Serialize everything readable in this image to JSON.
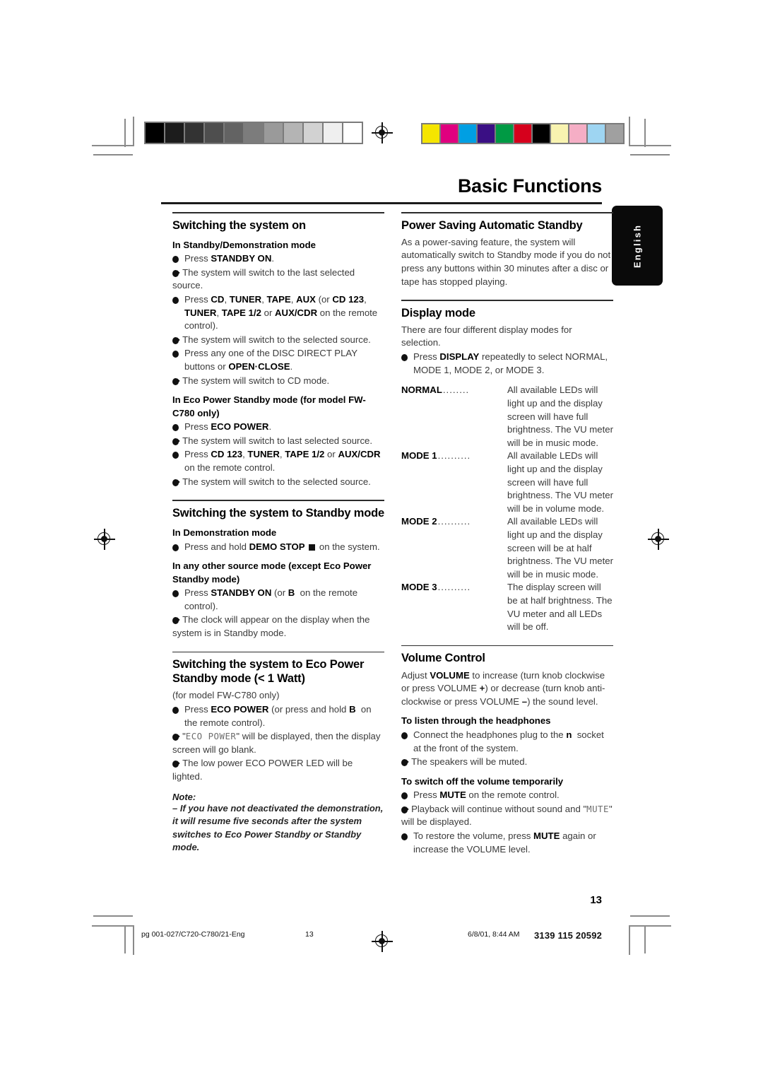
{
  "document": {
    "title": "Basic Functions",
    "language_tab": "English",
    "page_number": "13"
  },
  "footer": {
    "file": "pg 001-027/C720-C780/21-Eng",
    "page": "13",
    "timestamp": "6/8/01, 8:44 AM",
    "code": "3139 115 20592"
  },
  "calibration": {
    "grayscale": [
      "#000000",
      "#1c1c1c",
      "#333333",
      "#4e4e4e",
      "#636363",
      "#7c7c7c",
      "#9a9a9a",
      "#b4b4b4",
      "#d2d2d2",
      "#efefef",
      "#ffffff"
    ],
    "colors": [
      "#f5e500",
      "#e0007f",
      "#009fe3",
      "#3a0f84",
      "#009a44",
      "#d6001c",
      "#000000",
      "#f8f3b0",
      "#f5aec5",
      "#9ed5f2",
      "#a0a0a0"
    ]
  },
  "left_column": [
    {
      "heading": "Switching the system on",
      "items": [
        {
          "type": "subhead",
          "text": "In Standby/Demonstration mode"
        },
        {
          "type": "bullet",
          "html": "Press <b>STANDBY ON</b>."
        },
        {
          "type": "arrow",
          "html": "The system will switch to the last selected source."
        },
        {
          "type": "bullet",
          "html": "Press <b>CD</b>, <b>TUNER</b>, <b>TAPE</b>, <b>AUX</b> (or <b>CD 123</b>, <b>TUNER</b>, <b>TAPE 1/2</b> or <b>AUX/CDR</b> on the remote control)."
        },
        {
          "type": "arrow",
          "html": "The system will switch to the selected source."
        },
        {
          "type": "bullet",
          "html": "Press any one of the DISC DIRECT PLAY buttons or <b>OPEN&middot;CLOSE</b>."
        },
        {
          "type": "arrow",
          "html": "The system will switch to CD mode."
        },
        {
          "type": "subhead",
          "text": "In Eco Power Standby mode (for model FW-C780 only)"
        },
        {
          "type": "bullet",
          "html": "Press <b>ECO POWER</b>."
        },
        {
          "type": "arrow",
          "html": "The system will switch to last selected source."
        },
        {
          "type": "bullet",
          "html": "Press <b>CD 123</b>, <b>TUNER</b>, <b>TAPE 1/2</b> or <b>AUX/CDR</b> on the remote control."
        },
        {
          "type": "arrow",
          "html": "The system will switch to the selected source."
        }
      ]
    },
    {
      "heading": "Switching the system to Standby mode",
      "items": [
        {
          "type": "subhead",
          "text": "In Demonstration mode"
        },
        {
          "type": "bullet",
          "html": "Press and hold <b>DEMO STOP</b> <span class=\"sq\"></span> on the system."
        },
        {
          "type": "subhead",
          "text": "In any other source mode (except Eco Power Standby mode)"
        },
        {
          "type": "bullet",
          "html": "Press <b>STANDBY ON</b> (or <b>B</b>&nbsp; on the remote control)."
        },
        {
          "type": "arrow",
          "html": "The clock will appear on the display when the system is in Standby mode."
        }
      ]
    },
    {
      "heading": "Switching the system to Eco Power Standby mode (< 1 Watt)",
      "items": [
        {
          "type": "plain",
          "html": "(for model FW-C780 only)"
        },
        {
          "type": "bullet",
          "html": "Press <b>ECO POWER</b> (or press and hold <b>B</b>&nbsp; on the remote control)."
        },
        {
          "type": "arrow",
          "html": "\"<span class=\"lcd\">ECO POWER</span>\" will be displayed, then the display screen will go blank."
        },
        {
          "type": "arrow",
          "html": "The low power ECO POWER LED will be lighted."
        }
      ],
      "note": {
        "label": "Note:",
        "text": "–  If you have not deactivated the demonstration, it will resume five seconds after the system switches to Eco Power Standby or Standby mode."
      }
    }
  ],
  "right_column": [
    {
      "heading": "Power Saving Automatic Standby",
      "items": [
        {
          "type": "plain",
          "html": "As a power-saving feature, the system will automatically switch to Standby mode if you do not press any buttons within 30 minutes after a disc or tape has stopped playing."
        }
      ]
    },
    {
      "heading": "Display mode",
      "items": [
        {
          "type": "plain",
          "html": "There are four different display modes for selection."
        },
        {
          "type": "bullet",
          "html": "Press <b>DISPLAY</b> repeatedly to select NORMAL, MODE 1, MODE 2, or MODE 3."
        }
      ],
      "definitions": [
        {
          "term": "NORMAL",
          "leader": "........",
          "desc": "All available LEDs will light up and the display screen will have full brightness. The VU meter will be in music mode."
        },
        {
          "term": "MODE 1",
          "leader": "..........",
          "desc": "All available LEDs will light up and the display screen will have full brightness. The VU meter will be in volume mode."
        },
        {
          "term": "MODE 2",
          "leader": "..........",
          "desc": "All available LEDs will light up and the display screen will be at half brightness. The VU meter will be in music mode."
        },
        {
          "term": "MODE 3",
          "leader": "..........",
          "desc": "The display screen will be at half brightness. The VU meter and all LEDs will be off."
        }
      ]
    },
    {
      "heading": "Volume Control",
      "items": [
        {
          "type": "plain",
          "html": "Adjust <b>VOLUME</b> to increase (turn knob clockwise or press VOLUME <span class=\"inlineicon\">+</span>) or decrease (turn knob anti-clockwise or press VOLUME <span class=\"inlineicon\">&ndash;</span>) the sound level."
        },
        {
          "type": "subhead",
          "text": "To listen through the headphones"
        },
        {
          "type": "bullet",
          "html": "Connect the headphones plug to the <b>n</b>&nbsp; socket at the front of the system."
        },
        {
          "type": "arrow",
          "html": "The speakers will be muted."
        },
        {
          "type": "subhead",
          "text": "To switch off the volume temporarily"
        },
        {
          "type": "bullet",
          "html": "Press <b>MUTE</b> on the remote control."
        },
        {
          "type": "arrow",
          "html": "Playback will continue without sound and \"<span class=\"lcd\">MUTE</span>\" will be displayed."
        },
        {
          "type": "bullet",
          "html": "To restore the volume, press <b>MUTE</b> again or increase the VOLUME level."
        }
      ]
    }
  ]
}
